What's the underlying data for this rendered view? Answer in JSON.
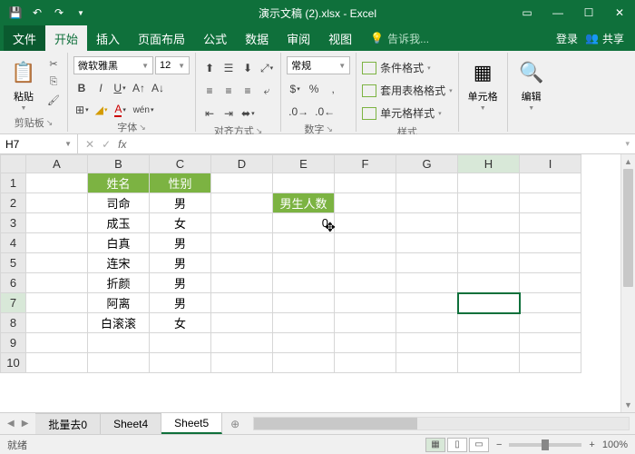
{
  "titlebar": {
    "title": "演示文稿 (2).xlsx - Excel"
  },
  "menu": {
    "file": "文件",
    "home": "开始",
    "insert": "插入",
    "pagelayout": "页面布局",
    "formulas": "公式",
    "data": "数据",
    "review": "审阅",
    "view": "视图",
    "tellme": "告诉我...",
    "login": "登录",
    "share": "共享"
  },
  "ribbon": {
    "clipboard": {
      "paste": "粘贴",
      "label": "剪贴板"
    },
    "font": {
      "name": "微软雅黑",
      "size": "12",
      "label": "字体"
    },
    "align": {
      "label": "对齐方式"
    },
    "number": {
      "format": "常规",
      "label": "数字"
    },
    "styles": {
      "cond": "条件格式",
      "table": "套用表格格式",
      "cell": "单元格样式",
      "label": "样式"
    },
    "cells": {
      "label": "单元格"
    },
    "editing": {
      "label": "编辑"
    }
  },
  "namebox": {
    "ref": "H7",
    "formula": ""
  },
  "grid": {
    "cols": [
      "A",
      "B",
      "C",
      "D",
      "E",
      "F",
      "G",
      "H",
      "I"
    ],
    "rows": [
      "1",
      "2",
      "3",
      "4",
      "5",
      "6",
      "7",
      "8",
      "9",
      "10"
    ],
    "headers": {
      "b1": "姓名",
      "c1": "性别",
      "e2": "男生人数"
    },
    "data": {
      "b2": "司命",
      "c2": "男",
      "b3": "成玉",
      "c3": "女",
      "b4": "白真",
      "c4": "男",
      "b5": "连宋",
      "c5": "男",
      "b6": "折颜",
      "c6": "男",
      "b7": "阿离",
      "c7": "男",
      "b8": "白滚滚",
      "c8": "女",
      "e3": "0"
    }
  },
  "sheets": {
    "s1": "批量去0",
    "s2": "Sheet4",
    "s3": "Sheet5"
  },
  "status": {
    "ready": "就绪",
    "zoom": "100%"
  },
  "chart_data": null
}
